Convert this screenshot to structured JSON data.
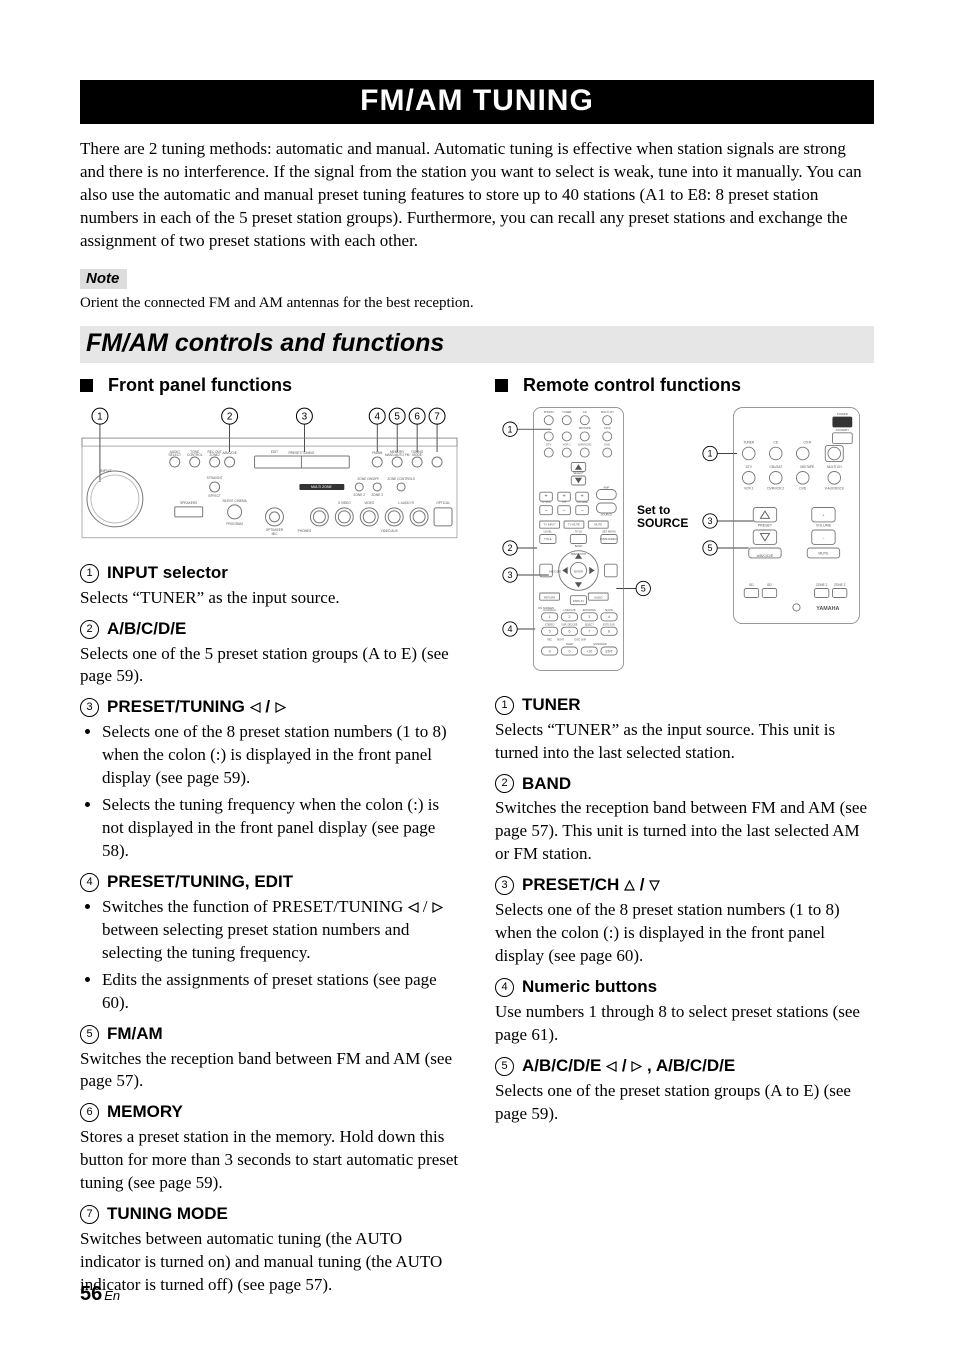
{
  "banner": "FM/AM TUNING",
  "intro": "There are 2 tuning methods: automatic and manual. Automatic tuning is effective when station signals are strong and there is no interference. If the signal from the station you want to select is weak, tune into it manually. You can also use the automatic and manual preset tuning features to store up to 40 stations (A1 to E8: 8 preset station numbers in each of the 5 preset station groups). Furthermore, you can recall any preset stations and exchange the assignment of two preset stations with each other.",
  "note_label": "Note",
  "note_text": "Orient the connected FM and AM antennas for the best reception.",
  "section_title": "FM/AM controls and functions",
  "left": {
    "heading": "Front panel functions",
    "items": {
      "n1": {
        "num": "1",
        "title": "INPUT selector",
        "body": "Selects “TUNER” as the input source."
      },
      "n2": {
        "num": "2",
        "title": "A/B/C/D/E",
        "body": "Selects one of the 5 preset station groups (A to E) (see page 59)."
      },
      "n3": {
        "num": "3",
        "title_a": "PRESET/TUNING",
        "title_b": "/",
        "b1": "Selects one of the 8 preset station numbers (1 to 8) when the colon (:) is displayed in the front panel display (see page 59).",
        "b2": "Selects the tuning frequency when the colon (:) is not displayed in the front panel display (see page 58)."
      },
      "n4": {
        "num": "4",
        "title": "PRESET/TUNING, EDIT",
        "b1_a": "Switches the function of PRESET/TUNING",
        "b1_b": "/",
        "b1_c": "between selecting preset station numbers and selecting the tuning frequency.",
        "b2": "Edits the assignments of preset stations (see page 60)."
      },
      "n5": {
        "num": "5",
        "title": "FM/AM",
        "body": "Switches the reception band between FM and AM (see page 57)."
      },
      "n6": {
        "num": "6",
        "title": "MEMORY",
        "body": "Stores a preset station in the memory. Hold down this button for more than 3 seconds to start automatic preset tuning (see page 59)."
      },
      "n7": {
        "num": "7",
        "title": "TUNING MODE",
        "body": "Switches between automatic tuning (the AUTO indicator is turned on) and manual tuning (the AUTO indicator is turned off) (see page 57)."
      }
    }
  },
  "right": {
    "heading": "Remote control functions",
    "set_to": "Set to",
    "source": "SOURCE",
    "items": {
      "n1": {
        "num": "1",
        "title": "TUNER",
        "body": "Selects “TUNER” as the input source. This unit is turned into the last selected station."
      },
      "n2": {
        "num": "2",
        "title": "BAND",
        "body": "Switches the reception band between FM and AM (see page 57). This unit is turned into the last selected AM or FM station."
      },
      "n3": {
        "num": "3",
        "title_a": "PRESET/CH",
        "title_b": "/",
        "body": "Selects one of the 8 preset station numbers (1 to 8) when the colon (:) is displayed in the front panel display (see page 60)."
      },
      "n4": {
        "num": "4",
        "title": "Numeric buttons",
        "body": "Use numbers 1 through 8 to select preset stations (see page 61)."
      },
      "n5": {
        "num": "5",
        "title_a": "A/B/C/D/E",
        "title_b": "/",
        "title_c": ", A/B/C/D/E",
        "body": "Selects one of the preset station groups (A to E) (see page 59)."
      }
    }
  },
  "footer": {
    "page": "56",
    "lang": "En"
  },
  "diagram_labels": {
    "front_numbers": [
      "1",
      "2",
      "3",
      "4",
      "5",
      "6",
      "7"
    ],
    "remote_left_numbers": [
      "1",
      "2",
      "3",
      "4",
      "5"
    ],
    "remote_right_numbers": [
      "1",
      "3",
      "5"
    ],
    "front_small": [
      "INPUT",
      "AUDIO SELECT",
      "TONE CONTROL",
      "REC OUT ZONE2",
      "A/B/C/D/E",
      "STRAIGHT",
      "EFFECT",
      "SPEAKERS",
      "SILENT CINEMA",
      "PROGRAM",
      "OPTIMIZER MIC",
      "PHONES",
      "S VIDEO",
      "VIDEO",
      "VIDEO AUX",
      "L  AUDIO  R",
      "OPTICAL",
      "PRESET/TUNING",
      "EDIT",
      "PRESET/TUNING",
      "FM/AM",
      "MAN'L/AUTO FM",
      "TUNING MODE",
      "MEMORY",
      "AUTO/MAN'L",
      "MULTI ZONE",
      "ZONE ON/OFF",
      "ZONE CONTROLS",
      "ZONE 2",
      "ZONE 3"
    ],
    "remote_small": [
      "PHONO",
      "TUNER",
      "CD",
      "MULTI CH",
      "CD-R",
      "MD/TAPE",
      "DVR/VCR2",
      "DVD",
      "DTV",
      "VCR 1",
      "V-AUX/DOCK",
      "SELECT",
      "TV VOL",
      "CH",
      "VOLUME",
      "SRCH MODE",
      "AMP",
      "SOURCE",
      "TV INPUT",
      "TV MUTE",
      "MUTE",
      "LEVEL",
      "TITLE",
      "BAND",
      "MENU",
      "SET MENU",
      "PURE DIRECT",
      "ENTER",
      "RETURN",
      "DISPLAY",
      "AUDIO",
      "ON SCREEN",
      "A/B/C/D/E",
      "PRESET/CH",
      "REC",
      "DISC SKIP",
      "CLASSICAL",
      "LIVE/CLUB",
      "ENTERTAIN",
      "MOVIE",
      "STEREO",
      "SUR. DECODE",
      "SELECT",
      "EXTD SUR.",
      "NIGHT",
      "SLEEP",
      "ENHANCER",
      "1",
      "2",
      "3",
      "4",
      "5",
      "6",
      "7",
      "8",
      "9",
      "0",
      "+10",
      "ENT",
      "POWER",
      "STANDBY",
      "ID1",
      "ID2",
      "ZONE 2",
      "ZONE 3",
      "PRESET",
      "YAMAHA"
    ]
  }
}
